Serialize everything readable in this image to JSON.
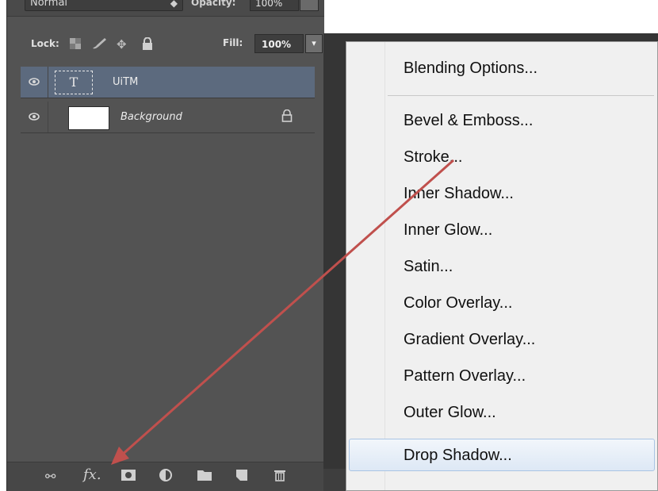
{
  "layers_panel": {
    "blend_mode": "Normal",
    "opacity_label": "Opacity:",
    "opacity_value": "100%",
    "lock_label": "Lock:",
    "fill_label": "Fill:",
    "fill_value": "100%",
    "layers": [
      {
        "name": "UiTM",
        "type": "text",
        "selected": true,
        "thumb_glyph": "T"
      },
      {
        "name": "Background",
        "type": "background",
        "selected": false,
        "locked": true
      }
    ],
    "bottom_icons": [
      "link-icon",
      "fx-icon",
      "mask-icon",
      "adjustment-icon",
      "folder-icon",
      "new-layer-icon",
      "trash-icon"
    ],
    "fx_text": "fx"
  },
  "context_menu": {
    "items": [
      "Blending Options...",
      "Bevel & Emboss...",
      "Stroke...",
      "Inner Shadow...",
      "Inner Glow...",
      "Satin...",
      "Color Overlay...",
      "Gradient Overlay...",
      "Pattern Overlay...",
      "Outer Glow...",
      "Drop Shadow..."
    ],
    "highlighted": "Drop Shadow..."
  },
  "colors": {
    "panel_bg": "#535353",
    "selected_layer": "#5c6a7e",
    "menu_bg": "#f0f0f0",
    "arrow": "#c0504d"
  }
}
